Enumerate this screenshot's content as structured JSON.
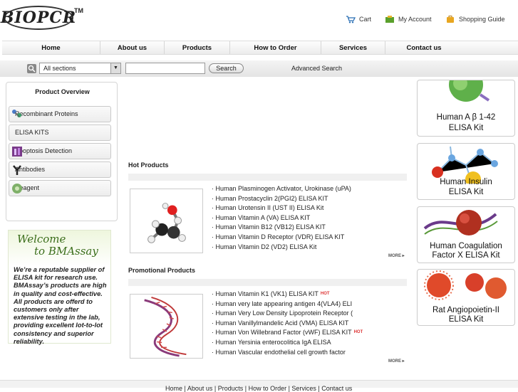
{
  "header": {
    "logo_text": "BIOPCR",
    "logo_tm": "TM",
    "links": {
      "cart": "Cart",
      "account": "My Account",
      "guide": "Shopping Guide"
    }
  },
  "nav": [
    "Home",
    "About us",
    "Products",
    "How to Order",
    "Services",
    "Contact us"
  ],
  "search": {
    "section": "All sections",
    "button": "Search",
    "advanced": "Advanced Search"
  },
  "sidebar": {
    "title": "Product Overview",
    "items": [
      "Recombinant Proteins",
      "ELISA KITS",
      "Apoptosis Detection",
      "Antibodies",
      "Reagent"
    ]
  },
  "welcome": {
    "line1": "Welcome",
    "line2": "to  BMAssay",
    "text": "We’re a reputable supplier of ELISA kit for research use. BMAssay’s products are high in quality and cost-effective. All products are offerd to customers only after extensive testing in the lab, providing excellent lot-to-lot consistency and superior reliability."
  },
  "hot": {
    "title": "Hot Products",
    "items": [
      "Human Plasminogen Activator, Urokinase (uPA)",
      "Human Prostacyclin 2(PGI2) ELISA KIT",
      "Human Urotensin II (UST II) ELISA Kit",
      "Human Vitamin A (VA) ELISA KIT",
      "Human Vitamin B12 (VB12) ELISA KIT",
      "Human Vitamin D Receptor (VDR) ELISA KIT",
      "Human Vitamin D2 (VD2) ELISA Kit"
    ],
    "more": "MORE"
  },
  "promo": {
    "title": "Promotional Products",
    "items": [
      "Human Vitamin K1 (VK1) ELISA KIT",
      "Human very late appearing antigen 4(VLA4) ELI",
      "Human Very Low Density Lipoprotein Receptor (",
      "Human Vanillylmandelic Acid (VMA) ELISA KIT",
      "Human Von Willebrand Factor (vWF) ELISA KIT",
      "Human Yersinia enterocolitica IgA ELISA",
      "Human Vascular endothelial cell growth factor"
    ],
    "hot_badge": "HOT",
    "more": "MORE"
  },
  "ads": [
    {
      "line1": "Human A β 1-42",
      "line2": "ELISA Kit"
    },
    {
      "line1": "Human Insulin",
      "line2": "ELISA Kit"
    },
    {
      "line1": "Human Coagulation",
      "line2": "Factor X ELISA Kit"
    },
    {
      "line1": "Rat Angiopoietin-II",
      "line2": "ELISA Kit"
    }
  ],
  "footer": "Home | About us | Products | How to Order | Services | Contact us"
}
